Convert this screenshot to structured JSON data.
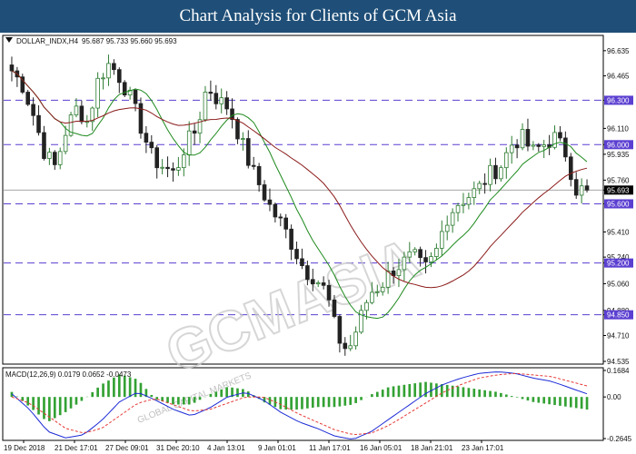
{
  "header": {
    "title": "Chart Analysis for Clients of GCM Asia"
  },
  "watermark": {
    "brand": "GCMASIA",
    "tagline": "GLOBAL CAPITAL MARKETS"
  },
  "colors": {
    "header_bg": "#1f4f78",
    "bull": "#2e7d32",
    "bear": "#222222",
    "ma_fast": "#1e8a1e",
    "ma_slow": "#8b1a1a",
    "level": "#5b3fd1",
    "macd_line": "#1d2bd6",
    "signal_line": "#e53935",
    "hist": "#33a133",
    "price_tag_bg": "#000000",
    "level_tag_bg": "#5b3fd1"
  },
  "chart_data": [
    {
      "type": "candlestick",
      "title": "DOLLAR_INDX,H4",
      "ohlc_label": "95.687 95.733 95.660 95.693",
      "ylim": [
        94.535,
        96.72
      ],
      "yticks": [
        "96.635",
        "96.465",
        "96.300",
        "96.110",
        "96.000",
        "95.935",
        "95.760",
        "95.693",
        "95.600",
        "95.410",
        "95.240",
        "95.200",
        "95.060",
        "94.880",
        "94.850",
        "94.710",
        "94.535"
      ],
      "levels": [
        96.3,
        96.0,
        95.6,
        95.2,
        94.85
      ],
      "current_price": 95.693,
      "xticks": [
        "19 Dec 2018",
        "21 Dec 17:01",
        "27 Dec 09:01",
        "31 Dec 20:10",
        "4 Jan 13:01",
        "9 Jan 01:01",
        "11 Jan 17:01",
        "16 Jan 05:01",
        "18 Jan 21:01",
        "23 Jan 17:01"
      ],
      "close_path": [
        96.5,
        96.4,
        96.2,
        95.95,
        95.85,
        96.1,
        96.25,
        96.15,
        96.45,
        96.55,
        96.45,
        96.3,
        96.1,
        95.9,
        95.85,
        95.8,
        96.0,
        96.1,
        96.4,
        96.3,
        96.25,
        96.05,
        95.85,
        95.7,
        95.55,
        95.45,
        95.3,
        95.15,
        95.1,
        95.0,
        94.7,
        94.6,
        94.8,
        95.0,
        95.05,
        95.15,
        95.2,
        95.25,
        95.15,
        95.25,
        95.5,
        95.6,
        95.65,
        95.7,
        95.8,
        95.85,
        96.0,
        96.05,
        95.95,
        96.0,
        96.05,
        95.95,
        95.7,
        95.693
      ],
      "n_candles": 108
    },
    {
      "type": "macd",
      "title": "MACD(12,26,9) 0.0179 0.0652 -0.0473",
      "ylim": [
        -0.2645,
        0.1684
      ],
      "yticks": [
        "0.1684",
        "0.00",
        "-0.2645"
      ],
      "macd_path": [
        0.02,
        -0.08,
        -0.22,
        -0.26,
        -0.24,
        -0.15,
        -0.03,
        0.03,
        -0.02,
        -0.08,
        -0.12,
        -0.07,
        0.0,
        0.03,
        -0.02,
        -0.1,
        -0.16,
        -0.2,
        -0.25,
        -0.27,
        -0.22,
        -0.14,
        -0.06,
        0.02,
        0.08,
        0.12,
        0.15,
        0.16,
        0.15,
        0.12,
        0.1,
        0.06,
        0.02
      ],
      "signal_path": [
        0.0,
        -0.04,
        -0.12,
        -0.2,
        -0.23,
        -0.2,
        -0.12,
        -0.04,
        -0.01,
        -0.05,
        -0.09,
        -0.08,
        -0.04,
        0.0,
        0.0,
        -0.05,
        -0.11,
        -0.16,
        -0.21,
        -0.24,
        -0.23,
        -0.18,
        -0.11,
        -0.04,
        0.03,
        0.08,
        0.12,
        0.14,
        0.15,
        0.14,
        0.13,
        0.1,
        0.07
      ]
    }
  ]
}
